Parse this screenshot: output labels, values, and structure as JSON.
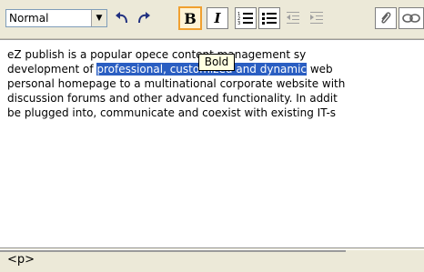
{
  "toolbar": {
    "style_select": {
      "value": "Normal"
    },
    "bold_label": "B",
    "italic_label": "I"
  },
  "tooltip": {
    "text": "Bold"
  },
  "editor": {
    "lines": [
      {
        "before": "eZ publish is a popular ope",
        "selected": "",
        "after": "ce content management sy"
      },
      {
        "before": "development of ",
        "selected": "professional, customized and dynamic",
        "after": " web"
      },
      {
        "before": "personal homepage to a multinational corporate website with",
        "selected": "",
        "after": ""
      },
      {
        "before": "discussion forums and other advanced functionality. In addit",
        "selected": "",
        "after": ""
      },
      {
        "before": "be plugged into, communicate and coexist with existing IT-s",
        "selected": "",
        "after": ""
      }
    ]
  },
  "status": {
    "path": "<p>"
  }
}
